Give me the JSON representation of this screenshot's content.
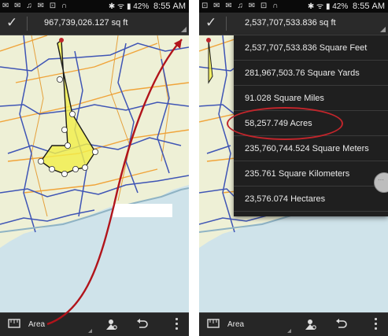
{
  "left": {
    "status": {
      "notifications": "✉ ✉ ♫ ✉ ⊡ ∩",
      "bt_wifi": "✱ ᯤ ▮",
      "battery": "42%",
      "time": "8:55 AM"
    },
    "measure_value": "967,739,026.127 sq ft",
    "bottom": {
      "mode_label": "Area"
    }
  },
  "right": {
    "status": {
      "notifications": "⊡ ✉ ✉ ♫ ✉ ⊡ ∩",
      "bt_wifi": "✱ ᯤ ▮",
      "battery": "42%",
      "time": "8:55 AM"
    },
    "measure_value": "2,537,707,533.836 sq ft",
    "bottom": {
      "mode_label": "Area"
    },
    "unit_options": [
      "2,537,707,533.836 Square Feet",
      "281,967,503.76 Square Yards",
      "91.028 Square Miles",
      "58,257.749 Acres",
      "235,760,744.524 Square Meters",
      "235.761 Square Kilometers",
      "23,576.074 Hectares"
    ],
    "highlighted_option": "58,257.749 Acres"
  },
  "colors": {
    "polygon_fill": "#f2ee4a",
    "highlight": "#c0252b",
    "boundary": "#3f55b5",
    "water": "#cfe3ea",
    "land": "#eef0d6"
  }
}
